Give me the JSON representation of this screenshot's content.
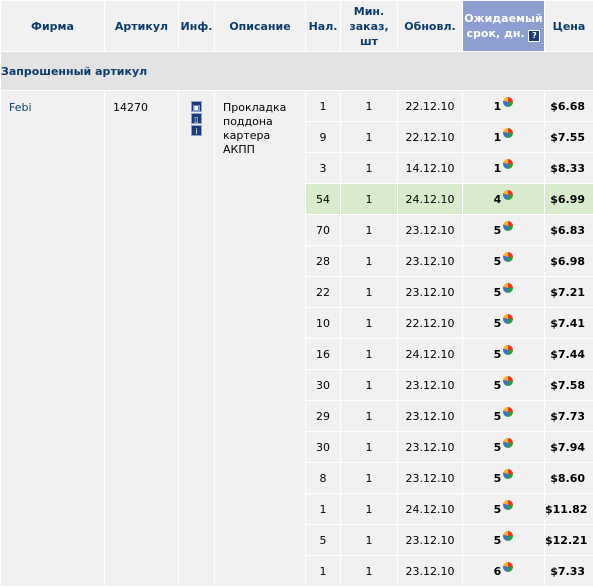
{
  "header": {
    "firm": "Фирма",
    "article": "Артикул",
    "info": "Инф.",
    "description": "Описание",
    "stock": "Нал.",
    "min_order_1": "Мин.",
    "min_order_2": "заказ,",
    "min_order_3": "шт",
    "updated": "Обновл.",
    "expected_1": "Ожидаемый",
    "expected_2": "срок, дн.",
    "help_icon": "?",
    "price": "Цена"
  },
  "section": {
    "title": "Запрошенный артикул"
  },
  "product": {
    "firm": "Febi",
    "article": "14270",
    "description": [
      "Прокладка",
      "поддона",
      "картера",
      "АКПП"
    ]
  },
  "rows": [
    {
      "stock": "1",
      "min": "1",
      "updated": "22.12.10",
      "days": "1",
      "price": "$6.68"
    },
    {
      "stock": "9",
      "min": "1",
      "updated": "22.12.10",
      "days": "1",
      "price": "$7.55"
    },
    {
      "stock": "3",
      "min": "1",
      "updated": "14.12.10",
      "days": "1",
      "price": "$8.33"
    },
    {
      "stock": "54",
      "min": "1",
      "updated": "24.12.10",
      "days": "4",
      "price": "$6.99"
    },
    {
      "stock": "70",
      "min": "1",
      "updated": "23.12.10",
      "days": "5",
      "price": "$6.83"
    },
    {
      "stock": "28",
      "min": "1",
      "updated": "23.12.10",
      "days": "5",
      "price": "$6.98"
    },
    {
      "stock": "22",
      "min": "1",
      "updated": "23.12.10",
      "days": "5",
      "price": "$7.21"
    },
    {
      "stock": "10",
      "min": "1",
      "updated": "22.12.10",
      "days": "5",
      "price": "$7.41"
    },
    {
      "stock": "16",
      "min": "1",
      "updated": "24.12.10",
      "days": "5",
      "price": "$7.44"
    },
    {
      "stock": "30",
      "min": "1",
      "updated": "23.12.10",
      "days": "5",
      "price": "$7.58"
    },
    {
      "stock": "29",
      "min": "1",
      "updated": "23.12.10",
      "days": "5",
      "price": "$7.73"
    },
    {
      "stock": "30",
      "min": "1",
      "updated": "23.12.10",
      "days": "5",
      "price": "$7.94"
    },
    {
      "stock": "8",
      "min": "1",
      "updated": "23.12.10",
      "days": "5",
      "price": "$8.60"
    },
    {
      "stock": "1",
      "min": "1",
      "updated": "24.12.10",
      "days": "5",
      "price": "$11.82"
    },
    {
      "stock": "5",
      "min": "1",
      "updated": "23.12.10",
      "days": "5",
      "price": "$12.21"
    },
    {
      "stock": "1",
      "min": "1",
      "updated": "23.12.10",
      "days": "6",
      "price": "$7.33"
    }
  ],
  "selected_row_index": 3,
  "colors": {
    "header_text": "#0c3c6c",
    "highlight_header_bg": "#8d9fd0",
    "selected_row_bg": "#d8ebcc",
    "cell_bg": "#f1f1f1",
    "section_bg": "#e3e3e3"
  },
  "icons": {
    "info_icons": [
      "photo-icon",
      "details-icon",
      "info-icon"
    ],
    "days_icon": "pie-chart-icon",
    "help": "help-icon"
  }
}
